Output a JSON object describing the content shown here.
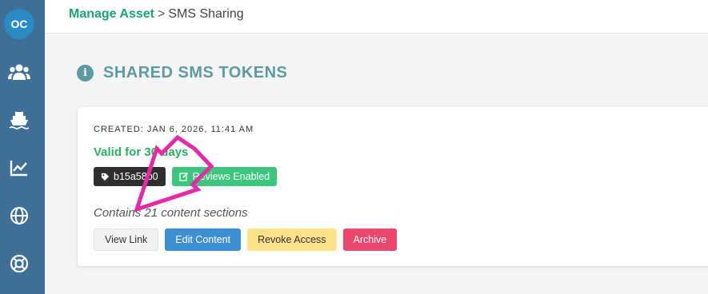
{
  "sidebar": {
    "avatar_initials": "OC",
    "items": [
      {
        "icon": "users-icon"
      },
      {
        "icon": "ship-icon"
      },
      {
        "icon": "chart-line-icon"
      },
      {
        "icon": "globe-icon"
      },
      {
        "icon": "lifebuoy-icon"
      }
    ]
  },
  "breadcrumb": {
    "parent": "Manage Asset",
    "separator": ">",
    "current": "SMS Sharing"
  },
  "page": {
    "title": "SHARED SMS TOKENS",
    "title_icon": "info-icon"
  },
  "token_card": {
    "created": "CREATED: JAN 6, 2026, 11:41 AM",
    "validity": "Valid for 30 days",
    "token_badge": "b15a58b0",
    "reviews_badge": "Reviews Enabled",
    "contains": "Contains 21 content sections",
    "buttons": {
      "view": "View Link",
      "edit": "Edit Content",
      "revoke": "Revoke Access",
      "archive": "Archive"
    }
  },
  "colors": {
    "sidebar": "#3f6f97",
    "accent_green": "#1aa37a",
    "title_teal": "#5d9aa2",
    "annotation_arrow": "#e52aa5"
  }
}
